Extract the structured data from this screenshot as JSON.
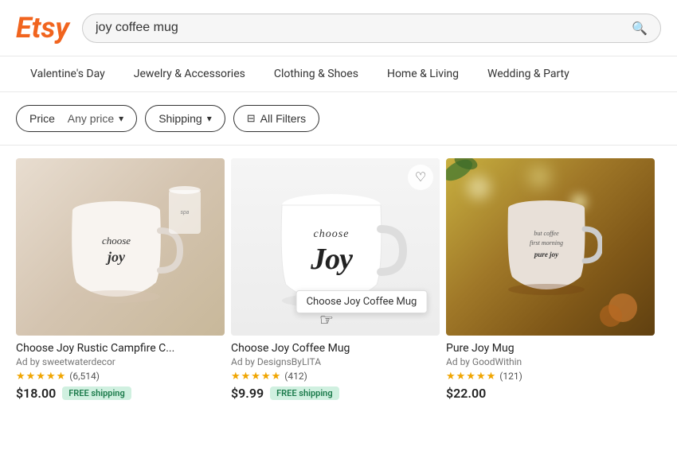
{
  "header": {
    "logo": "Etsy",
    "search_placeholder": "joy coffee mug",
    "search_value": "joy coffee mug"
  },
  "nav": {
    "items": [
      {
        "label": "Valentine's Day"
      },
      {
        "label": "Jewelry & Accessories"
      },
      {
        "label": "Clothing & Shoes"
      },
      {
        "label": "Home & Living"
      },
      {
        "label": "Wedding & Party"
      }
    ]
  },
  "filters": {
    "price_label": "Price",
    "price_value": "Any price",
    "shipping_label": "Shipping",
    "all_filters_label": "All Filters"
  },
  "products": [
    {
      "title": "Choose Joy Rustic Campfire C...",
      "ad_text": "Ad by sweetwaterdecor",
      "review_count": "(6,514)",
      "price": "$18.00",
      "free_shipping": "FREE shipping",
      "has_free_shipping": true
    },
    {
      "title": "Choose Joy Coffee Mug",
      "ad_text": "Ad by DesignsByLITA",
      "review_count": "(412)",
      "price": "$9.99",
      "free_shipping": "FREE shipping",
      "has_free_shipping": true,
      "tooltip": "Choose Joy Coffee Mug",
      "has_wishlist": true
    },
    {
      "title": "Pure Joy Mug",
      "ad_text": "Ad by GoodWithin",
      "review_count": "(121)",
      "price": "$22.00",
      "free_shipping": "",
      "has_free_shipping": false
    }
  ]
}
